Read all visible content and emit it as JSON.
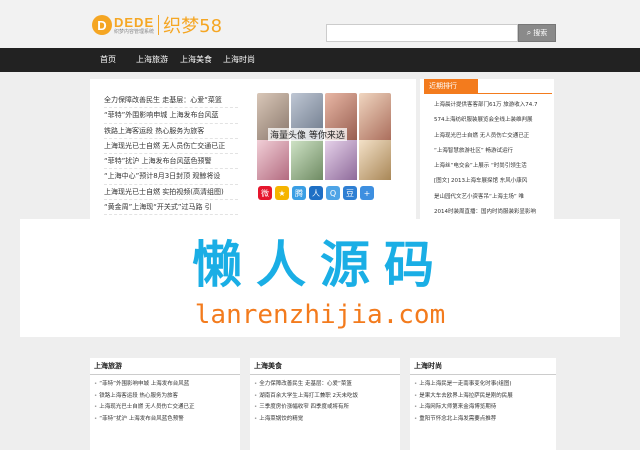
{
  "header": {
    "logo_mark": "D",
    "logo_brand": "DEDE",
    "logo_sub": "织梦内容管理系统",
    "logo_name": "织梦58",
    "search_placeholder": "",
    "search_button": "搜索"
  },
  "nav": {
    "items": [
      "首页",
      "上海旅游",
      "上海美食",
      "上海时尚"
    ]
  },
  "left_list": [
    "全力保障改善民生 走基层：心爱“菜篮",
    "“菲特”外围影响申城 上海发布台风蓝",
    "铁路上海客运段 热心服务为旅客",
    "上海现光已士自燃 无人员伤亡交通已正",
    "“菲特”扰沪 上海发布台风蓝色预警",
    "“上海中心”预计8月3日封顶 观鲸将设",
    "上海现光已士自燃 实拍视频(高清组图)",
    "“黄金周”上海现“开关式”过马路 引"
  ],
  "photo_caption": "海量头像  等你来选",
  "share_icons": [
    "weibo-icon",
    "qzone-icon",
    "tencent-weibo-icon",
    "renren-icon",
    "qq-icon",
    "douban-icon",
    "plus-icon"
  ],
  "share_glyphs": [
    "微",
    "★",
    "腾",
    "人",
    "Q",
    "豆",
    "+"
  ],
  "rank": {
    "title": "近期排行",
    "items": [
      "上海晨计提供客客部门61万 旅游收入74.7",
      "574上海纺织服装展览会全线上装维判展",
      "上海现光巴士自燃 无人员伤亡交通已正",
      "“上海智慧旅游社区”  畅游试运行",
      "上海丝“电交会”上展示 “时尚引领生活",
      "[图文] 2013上海车展探馆 东风小康风",
      "是山园代文艺小资客吊“上海主场”  唯",
      "2014时装周直播：国内时尚服装彩显影响"
    ]
  },
  "watermark": {
    "cn": "懒人源码",
    "en": "lanrenzhijia.com"
  },
  "columns": [
    {
      "title": "上海旅游",
      "items": [
        "“菲特”外围影响申城 上海发布台风蓝",
        "铁路上海客运段 热心服务为旅客",
        "上海现光巴士自燃 无人员伤亡交通已正",
        "“菲特”扰沪 上海发布台风蓝色预警"
      ]
    },
    {
      "title": "上海美食",
      "items": [
        "全力保障改善民生 走基层：心爱“菜篮",
        "湖南百余大学生上海打工兼职 2天未吃饭",
        "三季度房价涨幅收窄 四季度或将有所",
        "上海菜锅饺的精觉"
      ]
    },
    {
      "title": "上海时尚",
      "items": [
        "上海上海民是一走南事变化时事(组图)",
        "是果大车去欧界上海拉萨民是刚的民展",
        "上海网际大师第来金海博览期待",
        "重阳节怀念北上海发需要点推荐"
      ]
    }
  ]
}
